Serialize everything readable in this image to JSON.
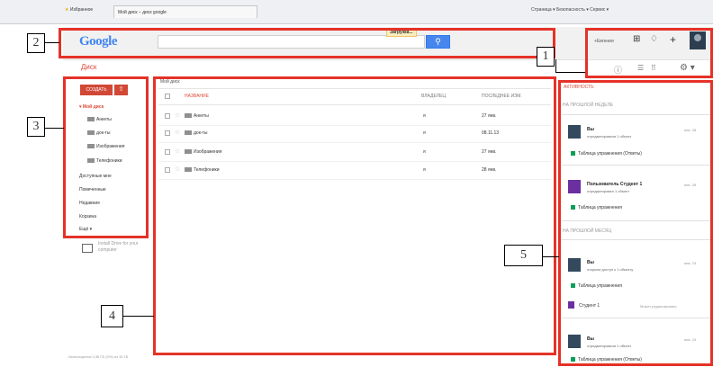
{
  "browser": {
    "favorites": "Избранное",
    "tab_title": "Мой диск – диск google",
    "tools": "Страница ▾  Безопасность ▾  Сервис ▾"
  },
  "header": {
    "logo": "Google",
    "loading": "Загрузка...",
    "user_name": "+Евгения",
    "search_placeholder": ""
  },
  "app": {
    "title": "Диск"
  },
  "sidebar": {
    "create_label": "СОЗДАТЬ",
    "upload_symbol": "⇧",
    "items": [
      {
        "label": "Мой диск"
      },
      {
        "label": "Анкеты"
      },
      {
        "label": "док-ты"
      },
      {
        "label": "Изображения"
      },
      {
        "label": "Телефоники"
      },
      {
        "label": "Доступные мне"
      },
      {
        "label": "Помеченные"
      },
      {
        "label": "Недавние"
      },
      {
        "label": "Корзина"
      },
      {
        "label": "Ещё ▾"
      }
    ],
    "promo": "Install Drive for your computer",
    "storage": "Используется 0,36 ГБ (0%) из 15 ГБ"
  },
  "filelist": {
    "breadcrumb": "Мой диск",
    "columns": {
      "name": "НАЗВАНИЕ",
      "owner": "ВЛАДЕЛЕЦ",
      "modified": "ПОСЛЕДНЕЕ ИЗМ."
    },
    "rows": [
      {
        "name": "Анкеты",
        "owner": "я",
        "date": "27 янв."
      },
      {
        "name": "док-ты",
        "owner": "я",
        "date": "08.11.13"
      },
      {
        "name": "Изображения",
        "owner": "я",
        "date": "27 янв."
      },
      {
        "name": "Телефоники",
        "owner": "я",
        "date": "28 янв."
      }
    ]
  },
  "activity": {
    "title": "АКТИВНОСТЬ",
    "sections": [
      "НА ПРОШЛОЙ НЕДЕЛЕ",
      "НА ПРОШЛОЙ МЕСЯЦ"
    ],
    "entries": [
      {
        "name": "Вы",
        "desc": "отредактировали 1 объект",
        "time": "янв. 28",
        "doc": "Таблица упражнения (Ответы)"
      },
      {
        "name": "Пользователь Студент 1",
        "desc": "отредактировал 1 объект",
        "time": "янв. 28",
        "doc": "Таблица упражнения"
      },
      {
        "name": "Вы",
        "desc": "открыли доступ к 1 объекту",
        "time": "янв. 15",
        "doc": "Таблица упражнения"
      },
      {
        "name": "Вы",
        "desc": "отредактировали 1 объект",
        "time": "янв. 15",
        "doc": "Таблица упражнения (Ответы)"
      }
    ],
    "student_label": "Студент 1",
    "student_note": "Может редактировать"
  },
  "callouts": [
    "1",
    "2",
    "3",
    "4",
    "5"
  ],
  "colors": {
    "accent_red": "#dd4b39",
    "search_blue": "#4787ed",
    "callout_red": "#e53228"
  }
}
